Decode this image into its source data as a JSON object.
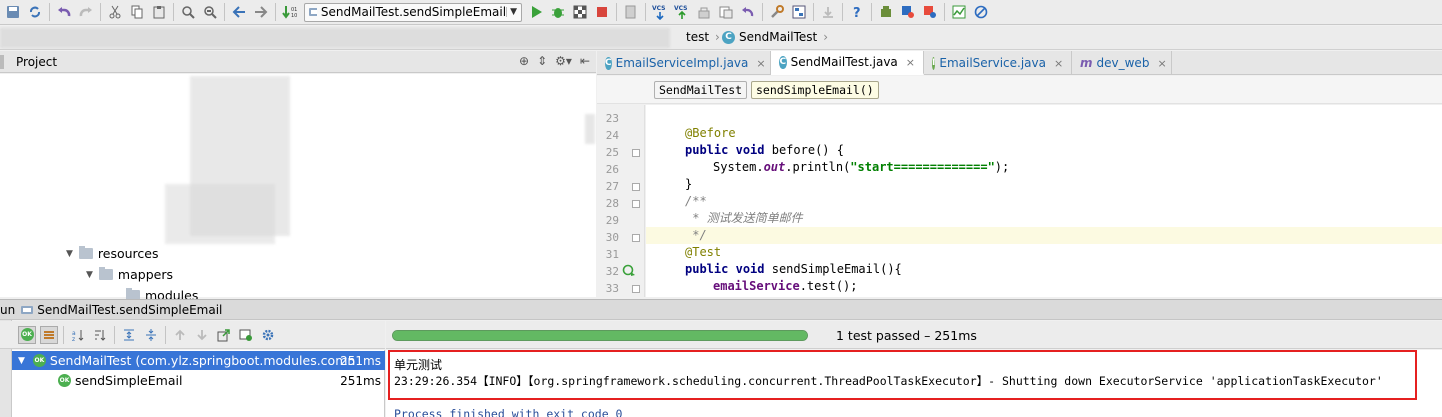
{
  "toolbar": {
    "run_config": "SendMailTest.sendSimpleEmail",
    "icons": [
      "save-icon",
      "sync-icon",
      "undo-icon",
      "redo-icon",
      "cut-icon",
      "copy-icon",
      "paste-icon",
      "find-icon",
      "replace-icon",
      "back-icon",
      "forward-icon",
      "build-icon",
      "run-icon",
      "debug-icon",
      "coverage-icon",
      "stop-icon",
      "sdk-icon",
      "vcs-update-icon",
      "vcs-commit-icon",
      "vcs-push-icon",
      "vcs-history-icon",
      "revert-icon",
      "settings-icon",
      "structure-icon",
      "sdk-manager-icon",
      "help-icon",
      "android-icon",
      "plugin-icon",
      "plugin2-icon",
      "monitor-icon",
      "disable-icon"
    ],
    "vcs_label": "VCS"
  },
  "navbar": {
    "crumb_test": "test",
    "crumb_class": "SendMailTest"
  },
  "project": {
    "title": "Project",
    "tree": [
      {
        "label": "resources"
      },
      {
        "label": "mappers"
      },
      {
        "label": "modules"
      }
    ]
  },
  "editor": {
    "tabs": [
      {
        "label": "EmailServiceImpl.java",
        "icon": "C"
      },
      {
        "label": "SendMailTest.java",
        "icon": "C"
      },
      {
        "label": "EmailService.java",
        "icon": "I"
      },
      {
        "label": "dev_web",
        "icon": "m"
      }
    ],
    "breadcrumbs": [
      "SendMailTest",
      "sendSimpleEmail()"
    ],
    "line_numbers": [
      "23",
      "24",
      "25",
      "26",
      "27",
      "28",
      "29",
      "30",
      "31",
      "32",
      "33"
    ],
    "code": {
      "l24_ann": "@Before",
      "l25_kw1": "public",
      "l25_kw2": "void",
      "l25_rest": " before() {",
      "l26_pre": "System.",
      "l26_field": "out",
      "l26_mid": ".println(",
      "l26_str": "\"start=============\"",
      "l26_end": ");",
      "l27": "}",
      "l28": "/**",
      "l29": " * 测试发送简单邮件",
      "l30": " */",
      "l31_ann": "@Test",
      "l32_kw1": "public",
      "l32_kw2": "void",
      "l32_rest": " sendSimpleEmail(){",
      "l33_field": "emailService",
      "l33_rest": ".test();"
    }
  },
  "run": {
    "header": "SendMailTest.sendSimpleEmail",
    "side_label": "un",
    "progress_text": "1 test passed – 251ms",
    "progress_fraction": 1.0,
    "tree": [
      {
        "label": "SendMailTest (com.ylz.springboot.modules.comn",
        "duration": "251ms"
      },
      {
        "label": "sendSimpleEmail",
        "duration": "251ms"
      }
    ],
    "ok_label": "OK",
    "console": [
      "单元测试",
      "23:29:26.354【INFO】【org.springframework.scheduling.concurrent.ThreadPoolTaskExecutor】- Shutting down ExecutorService 'applicationTaskExecutor'",
      "Process finished with exit code 0"
    ]
  },
  "colors": {
    "accent_blue": "#3875d7",
    "progress_green": "#63b963",
    "highlight_red": "#e52020",
    "line_highlight": "#fcfae1"
  }
}
